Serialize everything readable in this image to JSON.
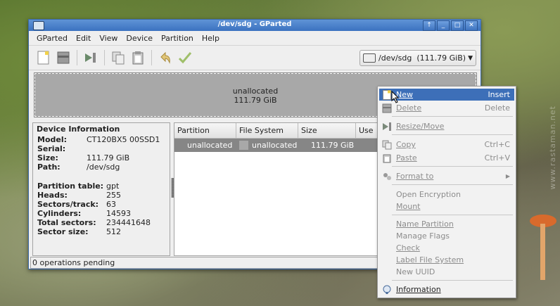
{
  "window": {
    "title": "/dev/sdg - GParted",
    "buttons": [
      "↑",
      "_",
      "□",
      "✕"
    ]
  },
  "menu": [
    "GParted",
    "Edit",
    "View",
    "Device",
    "Partition",
    "Help"
  ],
  "device_selector": {
    "label": "/dev/sdg  (111.79 GiB)"
  },
  "graph": {
    "name": "unallocated",
    "size": "111.79 GiB"
  },
  "device_info": {
    "header": "Device Information",
    "fields": [
      {
        "key": "Model:",
        "value": "CT120BX5 00SSD1"
      },
      {
        "key": "Serial:",
        "value": ""
      },
      {
        "key": "Size:",
        "value": "111.79 GiB"
      },
      {
        "key": "Path:",
        "value": "/dev/sdg"
      }
    ],
    "fields2": [
      {
        "key": "Partition table:",
        "value": "gpt"
      },
      {
        "key": "Heads:",
        "value": "255"
      },
      {
        "key": "Sectors/track:",
        "value": "63"
      },
      {
        "key": "Cylinders:",
        "value": "14593"
      },
      {
        "key": "Total sectors:",
        "value": "234441648"
      },
      {
        "key": "Sector size:",
        "value": "512"
      }
    ]
  },
  "partition_list": {
    "columns": [
      "Partition",
      "File System",
      "Size",
      "Use"
    ],
    "rows": [
      {
        "partition": "unallocated",
        "filesystem": "unallocated",
        "size": "111.79 GiB"
      }
    ]
  },
  "status": "0 operations pending",
  "context_menu": [
    {
      "label": "New",
      "accel": "Insert",
      "icon": "new-icon",
      "disabled": false,
      "highlight": true
    },
    {
      "label": "Delete",
      "accel": "Delete",
      "icon": "delete-icon",
      "disabled": true
    },
    {
      "sep": true
    },
    {
      "label": "Resize/Move",
      "accel": "",
      "icon": "resize-icon",
      "disabled": true
    },
    {
      "sep": true
    },
    {
      "label": "Copy",
      "accel": "Ctrl+C",
      "icon": "copy-icon",
      "disabled": true
    },
    {
      "label": "Paste",
      "accel": "Ctrl+V",
      "icon": "paste-icon",
      "disabled": true
    },
    {
      "sep": true
    },
    {
      "label": "Format to",
      "accel": "▶",
      "icon": "format-icon",
      "disabled": true
    },
    {
      "sep": true
    },
    {
      "label": "Open Encryption",
      "accel": "",
      "icon": "",
      "disabled": true
    },
    {
      "label": "Mount",
      "accel": "",
      "icon": "",
      "disabled": true
    },
    {
      "sep": true
    },
    {
      "label": "Name Partition",
      "accel": "",
      "icon": "",
      "disabled": true
    },
    {
      "label": "Manage Flags",
      "accel": "",
      "icon": "",
      "disabled": true
    },
    {
      "label": "Check",
      "accel": "",
      "icon": "",
      "disabled": true
    },
    {
      "label": "Label File System",
      "accel": "",
      "icon": "",
      "disabled": true
    },
    {
      "label": "New UUID",
      "accel": "",
      "icon": "",
      "disabled": true
    },
    {
      "sep": true
    },
    {
      "label": "Information",
      "accel": "",
      "icon": "info-icon",
      "disabled": false
    }
  ],
  "watermark": "www.rastaman.net",
  "colors": {
    "accent": "#3d6fb8",
    "unallocated": "#a8a8a8"
  }
}
